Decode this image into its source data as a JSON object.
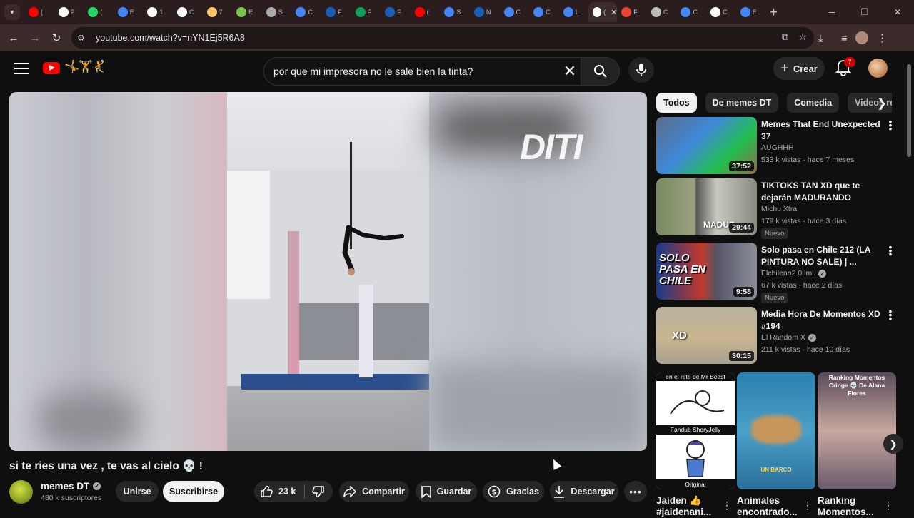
{
  "browser": {
    "url": "youtube.com/watch?v=nYN1Ej5R6A8",
    "tab_letters": [
      "(",
      "P",
      "(",
      "E",
      "1",
      "C",
      "7",
      "E",
      "S",
      "C",
      "F",
      "F",
      "F",
      "(",
      "S",
      "N",
      "C",
      "C",
      "L",
      "(",
      "F",
      "C",
      "C",
      "C",
      "E"
    ],
    "tab_colors": [
      "#ff0000",
      "#ffffff",
      "#25d366",
      "#4285f4",
      "#ffffff",
      "#ffffff",
      "#f4c46b",
      "#7cc34e",
      "#aaaaaa",
      "#4285f4",
      "#1a5fb4",
      "#0f9d58",
      "#1a5fb4",
      "#ff0000",
      "#4285f4",
      "#1a5fb4",
      "#4285f4",
      "#4285f4",
      "#4285f4",
      "#ffffff",
      "#ea4335",
      "#bbbbbb",
      "#4285f4",
      "#ffffff",
      "#4285f4"
    ],
    "active_tab": "(",
    "new_tab": "+"
  },
  "youtube": {
    "search_query": "por que mi impresora no le sale bien la tinta?",
    "create_label": "Crear",
    "notif_count": "7"
  },
  "video": {
    "watermark": "DITI",
    "title": "si te ries una vez , te vas al cielo 💀 !",
    "channel": "memes DT",
    "subscribers": "480 k suscriptores",
    "join_label": "Unirse",
    "subscribe_label": "Suscribirse",
    "likes": "23 k",
    "share_label": "Compartir",
    "save_label": "Guardar",
    "thanks_label": "Gracias",
    "download_label": "Descargar"
  },
  "chips": [
    "Todos",
    "De memes DT",
    "Comedia",
    "Videos re"
  ],
  "recommendations": [
    {
      "title": "Memes That End Unexpected 37",
      "channel": "AUGHHH",
      "verified": false,
      "meta": "533 k vistas · hace 7 meses",
      "duration": "37:52",
      "new": "",
      "thumb_color": "#4a90d9"
    },
    {
      "title": "TIKTOKS TAN XD que te dejarán MADURANDO",
      "channel": "Michu Xtra",
      "verified": false,
      "meta": "179 k vistas · hace 3 días",
      "duration": "29:44",
      "new": "Nuevo",
      "thumb_color": "#6b7b5a",
      "thumb_text": "MADUR"
    },
    {
      "title": "Solo pasa en Chile 212 (LA PINTURA NO SALE) | ...",
      "channel": "Elchileno2.0 lml.",
      "verified": true,
      "meta": "67 k vistas · hace 2 días",
      "duration": "9:58",
      "new": "Nuevo",
      "thumb_color": "#c0392b",
      "thumb_text": "SOLO PASA EN CHILE"
    },
    {
      "title": "Media Hora De Momentos XD #194",
      "channel": "El Random X",
      "verified": true,
      "meta": "211 k vistas · hace 10 días",
      "duration": "30:15",
      "new": "",
      "thumb_color": "#c9b58f",
      "thumb_text": "XD"
    }
  ],
  "shorts": [
    {
      "title": "Jaiden 👍 #jaidenani...",
      "top_caption": "en el reto de Mr Beast",
      "mid_caption": "Fandub SheryJelly",
      "bottom_caption": "Original"
    },
    {
      "title": "Animales encontrado...",
      "caption": "UN BARCO"
    },
    {
      "title": "Ranking Momentos...",
      "caption": "Ranking Momentos Cringe 💀 De Alana Flores"
    }
  ]
}
